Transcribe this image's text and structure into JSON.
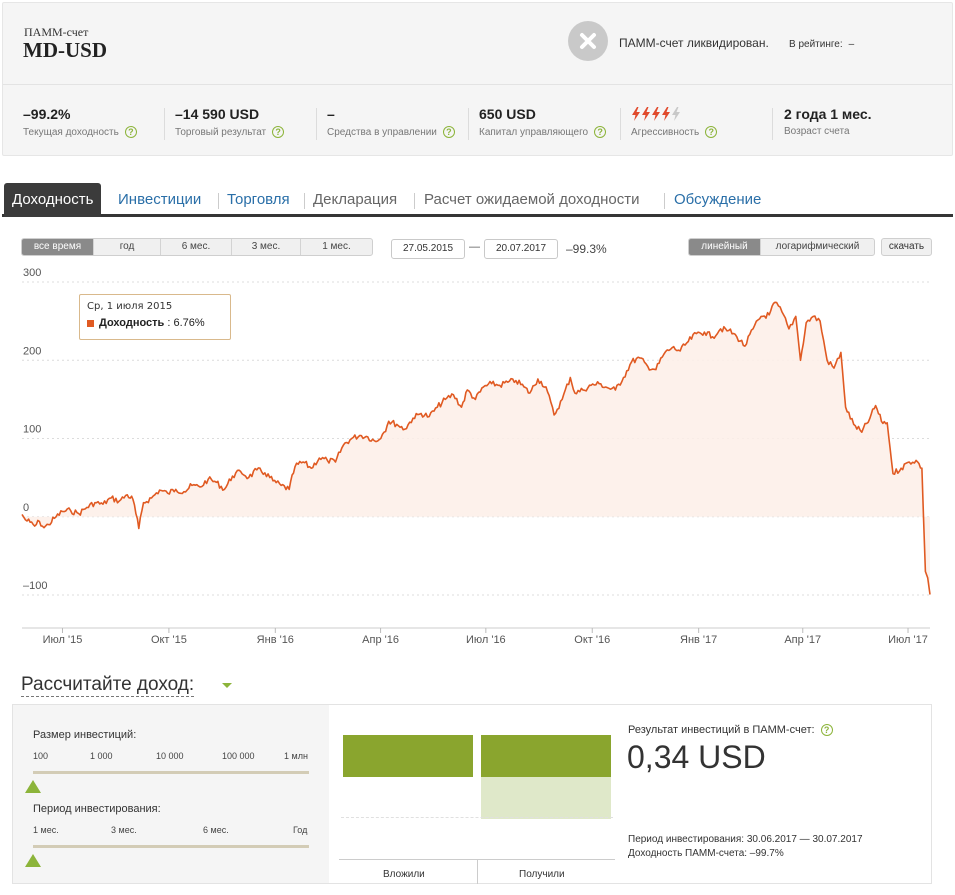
{
  "header": {
    "account_type": "ПАММ-счет",
    "account_name": "MD-USD",
    "liquidated_text": "ПАММ-счет ликвидирован.",
    "rating_label": "В рейтинге:",
    "rating_value": "–"
  },
  "stats": [
    {
      "value": "–99.2%",
      "label": "Текущая доходность",
      "help": "?"
    },
    {
      "value": "–14 590 USD",
      "label": "Торговый результат",
      "help": "?"
    },
    {
      "value": "–",
      "label": "Средства в управлении",
      "help": "?"
    },
    {
      "value": "650 USD",
      "label": "Капитал управляющего",
      "help": "?"
    },
    {
      "value": "",
      "label": "Агрессивность",
      "help": "?",
      "aggressiveness_level": 4,
      "aggressiveness_max": 5
    },
    {
      "value": "2 года 1 мес.",
      "label": "Возраст счета"
    }
  ],
  "tabs": [
    {
      "label": "Доходность",
      "state": "active"
    },
    {
      "label": "Инвестиции",
      "state": "link"
    },
    {
      "label": "Торговля",
      "state": "link"
    },
    {
      "label": "Декларация",
      "state": "plain"
    },
    {
      "label": "Расчет ожидаемой доходности",
      "state": "plain"
    },
    {
      "label": "Обсуждение",
      "state": "link"
    }
  ],
  "controls": {
    "periods": [
      "все время",
      "год",
      "6 мес.",
      "3 мес.",
      "1 мес."
    ],
    "active_period": "все время",
    "date_from": "27.05.2015",
    "date_to": "20.07.2017",
    "date_sep": "—",
    "range_return": "–99.3%",
    "scales": [
      "линейный",
      "логарифмический"
    ],
    "active_scale": "линейный",
    "download": "скачать"
  },
  "tooltip": {
    "date": "Ср, 1 июля 2015",
    "series": "Доходность",
    "value": "6.76%"
  },
  "chart_data": {
    "type": "area",
    "series": [
      {
        "name": "Доходность"
      }
    ],
    "ylim": [
      -100,
      300
    ],
    "yticks": [
      -100,
      0,
      100,
      200,
      300
    ],
    "ytick_labels": [
      "–100",
      "0",
      "100",
      "200",
      "300"
    ],
    "xlim": [
      "2015-05-27",
      "2017-07-20"
    ],
    "xticks": [
      "2015-07-01",
      "2015-10-01",
      "2016-01-01",
      "2016-04-01",
      "2016-07-01",
      "2016-10-01",
      "2017-01-01",
      "2017-04-01",
      "2017-07-01"
    ],
    "xtick_labels": [
      "Июл '15",
      "Окт '15",
      "Янв '16",
      "Апр '16",
      "Июл '16",
      "Окт '16",
      "Янв '17",
      "Апр '17",
      "Июл '17"
    ],
    "line_color": "#e05a22",
    "fill_color": "#fdeee8",
    "points": [
      [
        "2015-05-27",
        3
      ],
      [
        "2015-05-30",
        -4
      ],
      [
        "2015-06-03",
        -7
      ],
      [
        "2015-06-07",
        -12
      ],
      [
        "2015-06-11",
        -6
      ],
      [
        "2015-06-15",
        -14
      ],
      [
        "2015-06-19",
        -10
      ],
      [
        "2015-06-24",
        -2
      ],
      [
        "2015-07-01",
        6.76
      ],
      [
        "2015-07-08",
        8
      ],
      [
        "2015-07-15",
        4
      ],
      [
        "2015-07-22",
        12
      ],
      [
        "2015-07-29",
        18
      ],
      [
        "2015-08-05",
        16
      ],
      [
        "2015-08-12",
        24
      ],
      [
        "2015-08-19",
        20
      ],
      [
        "2015-08-26",
        28
      ],
      [
        "2015-08-31",
        22
      ],
      [
        "2015-09-05",
        -15
      ],
      [
        "2015-09-09",
        18
      ],
      [
        "2015-09-16",
        24
      ],
      [
        "2015-09-23",
        34
      ],
      [
        "2015-09-30",
        30
      ],
      [
        "2015-10-07",
        35
      ],
      [
        "2015-10-14",
        32
      ],
      [
        "2015-10-21",
        40
      ],
      [
        "2015-10-28",
        38
      ],
      [
        "2015-11-04",
        48
      ],
      [
        "2015-11-11",
        44
      ],
      [
        "2015-11-18",
        35
      ],
      [
        "2015-11-25",
        52
      ],
      [
        "2015-12-02",
        58
      ],
      [
        "2015-12-09",
        50
      ],
      [
        "2015-12-16",
        60
      ],
      [
        "2015-12-23",
        56
      ],
      [
        "2015-12-30",
        46
      ],
      [
        "2016-01-06",
        40
      ],
      [
        "2016-01-13",
        35
      ],
      [
        "2016-01-18",
        64
      ],
      [
        "2016-01-25",
        70
      ],
      [
        "2016-02-01",
        62
      ],
      [
        "2016-02-08",
        75
      ],
      [
        "2016-02-15",
        72
      ],
      [
        "2016-02-22",
        70
      ],
      [
        "2016-02-29",
        92
      ],
      [
        "2016-03-07",
        100
      ],
      [
        "2016-03-14",
        104
      ],
      [
        "2016-03-21",
        102
      ],
      [
        "2016-03-28",
        96
      ],
      [
        "2016-04-04",
        108
      ],
      [
        "2016-04-08",
        122
      ],
      [
        "2016-04-15",
        118
      ],
      [
        "2016-04-22",
        112
      ],
      [
        "2016-04-29",
        126
      ],
      [
        "2016-05-06",
        132
      ],
      [
        "2016-05-13",
        128
      ],
      [
        "2016-05-20",
        140
      ],
      [
        "2016-05-27",
        150
      ],
      [
        "2016-06-03",
        156
      ],
      [
        "2016-06-10",
        140
      ],
      [
        "2016-06-15",
        162
      ],
      [
        "2016-06-22",
        150
      ],
      [
        "2016-06-29",
        166
      ],
      [
        "2016-07-06",
        170
      ],
      [
        "2016-07-13",
        168
      ],
      [
        "2016-07-20",
        172
      ],
      [
        "2016-07-27",
        174
      ],
      [
        "2016-08-03",
        166
      ],
      [
        "2016-08-08",
        158
      ],
      [
        "2016-08-15",
        176
      ],
      [
        "2016-08-22",
        166
      ],
      [
        "2016-08-29",
        130
      ],
      [
        "2016-09-05",
        150
      ],
      [
        "2016-09-12",
        178
      ],
      [
        "2016-09-16",
        158
      ],
      [
        "2016-09-23",
        162
      ],
      [
        "2016-09-30",
        168
      ],
      [
        "2016-10-07",
        170
      ],
      [
        "2016-10-14",
        165
      ],
      [
        "2016-10-21",
        162
      ],
      [
        "2016-10-28",
        178
      ],
      [
        "2016-11-04",
        198
      ],
      [
        "2016-11-11",
        203
      ],
      [
        "2016-11-18",
        192
      ],
      [
        "2016-11-25",
        188
      ],
      [
        "2016-12-02",
        208
      ],
      [
        "2016-12-09",
        216
      ],
      [
        "2016-12-16",
        212
      ],
      [
        "2016-12-23",
        224
      ],
      [
        "2016-12-30",
        234
      ],
      [
        "2017-01-06",
        236
      ],
      [
        "2017-01-13",
        230
      ],
      [
        "2017-01-20",
        240
      ],
      [
        "2017-01-27",
        238
      ],
      [
        "2017-02-03",
        230
      ],
      [
        "2017-02-10",
        218
      ],
      [
        "2017-02-17",
        240
      ],
      [
        "2017-02-24",
        256
      ],
      [
        "2017-03-03",
        258
      ],
      [
        "2017-03-08",
        274
      ],
      [
        "2017-03-14",
        262
      ],
      [
        "2017-03-20",
        240
      ],
      [
        "2017-03-26",
        256
      ],
      [
        "2017-03-30",
        200
      ],
      [
        "2017-04-04",
        248
      ],
      [
        "2017-04-10",
        256
      ],
      [
        "2017-04-16",
        250
      ],
      [
        "2017-04-22",
        200
      ],
      [
        "2017-04-28",
        190
      ],
      [
        "2017-05-04",
        210
      ],
      [
        "2017-05-08",
        140
      ],
      [
        "2017-05-15",
        118
      ],
      [
        "2017-05-22",
        108
      ],
      [
        "2017-05-29",
        126
      ],
      [
        "2017-06-03",
        142
      ],
      [
        "2017-06-08",
        122
      ],
      [
        "2017-06-13",
        120
      ],
      [
        "2017-06-18",
        55
      ],
      [
        "2017-06-25",
        62
      ],
      [
        "2017-07-02",
        70
      ],
      [
        "2017-07-08",
        72
      ],
      [
        "2017-07-13",
        62
      ],
      [
        "2017-07-16",
        -70
      ],
      [
        "2017-07-18",
        -78
      ],
      [
        "2017-07-20",
        -99.3
      ]
    ]
  },
  "calculator": {
    "title": "Рассчитайте доход:",
    "investment_label": "Размер инвестиций:",
    "investment_ticks": [
      "100",
      "1 000",
      "10 000",
      "100 000",
      "1 млн"
    ],
    "investment_value": "100",
    "period_label": "Период инвестирования:",
    "period_ticks": [
      "1 мес.",
      "3 мес.",
      "6 мес.",
      "Год"
    ],
    "period_value": "1 мес.",
    "bars": {
      "invested": 100,
      "received": 0.34
    },
    "col_invested": "Вложили",
    "col_received": "Получили",
    "result_label": "Результат инвестиций в ПАММ-счет:",
    "result_help": "?",
    "result_value": "0,34 USD",
    "period_text": "Период инвестирования: 30.06.2017 — 30.07.2017",
    "yield_text": "Доходность ПАММ-счета: –99.7%"
  },
  "colors": {
    "accent_green": "#8cb43a",
    "link_blue": "#2a6fa8",
    "line_orange": "#e05a22",
    "bolt_active": "#e0492b",
    "bolt_inactive": "#c8c8c8"
  }
}
